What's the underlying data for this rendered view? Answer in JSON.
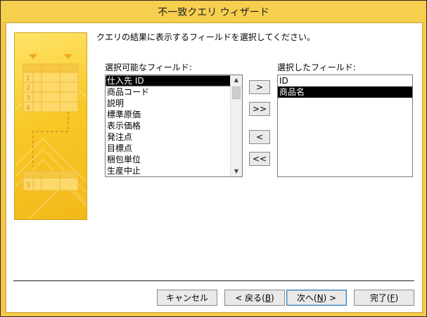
{
  "window": {
    "title": "不一致クエリ ウィザード"
  },
  "instruction": "クエリの結果に表示するフィールドを選択してください。",
  "available": {
    "label": "選択可能なフィールド:",
    "items": [
      "仕入先 ID",
      "商品コード",
      "説明",
      "標準原価",
      "表示価格",
      "発注点",
      "目標点",
      "梱包単位",
      "生産中止"
    ],
    "selected_index": 0
  },
  "chosen": {
    "label": "選択したフィールド:",
    "items": [
      "ID",
      "商品名"
    ],
    "selected_index": 1
  },
  "move_buttons": {
    "add": ">",
    "add_all": ">>",
    "remove": "<",
    "remove_all": "<<"
  },
  "footer": {
    "cancel": "キャンセル",
    "back_prefix": "< 戻る(",
    "back_key": "B",
    "back_suffix": ")",
    "next_prefix": "次へ(",
    "next_key": "N",
    "next_suffix": ") >",
    "finish_prefix": "完了(",
    "finish_key": "F",
    "finish_suffix": ")"
  },
  "side_panel": {
    "row_numbers": [
      "1",
      "2",
      "3",
      "4"
    ],
    "bottom_row_number": "3"
  },
  "colors": {
    "title_bar": "#f7cf4e",
    "selection": "#000000",
    "panel_light": "#ffe46a",
    "panel_dark": "#f3b81a"
  }
}
